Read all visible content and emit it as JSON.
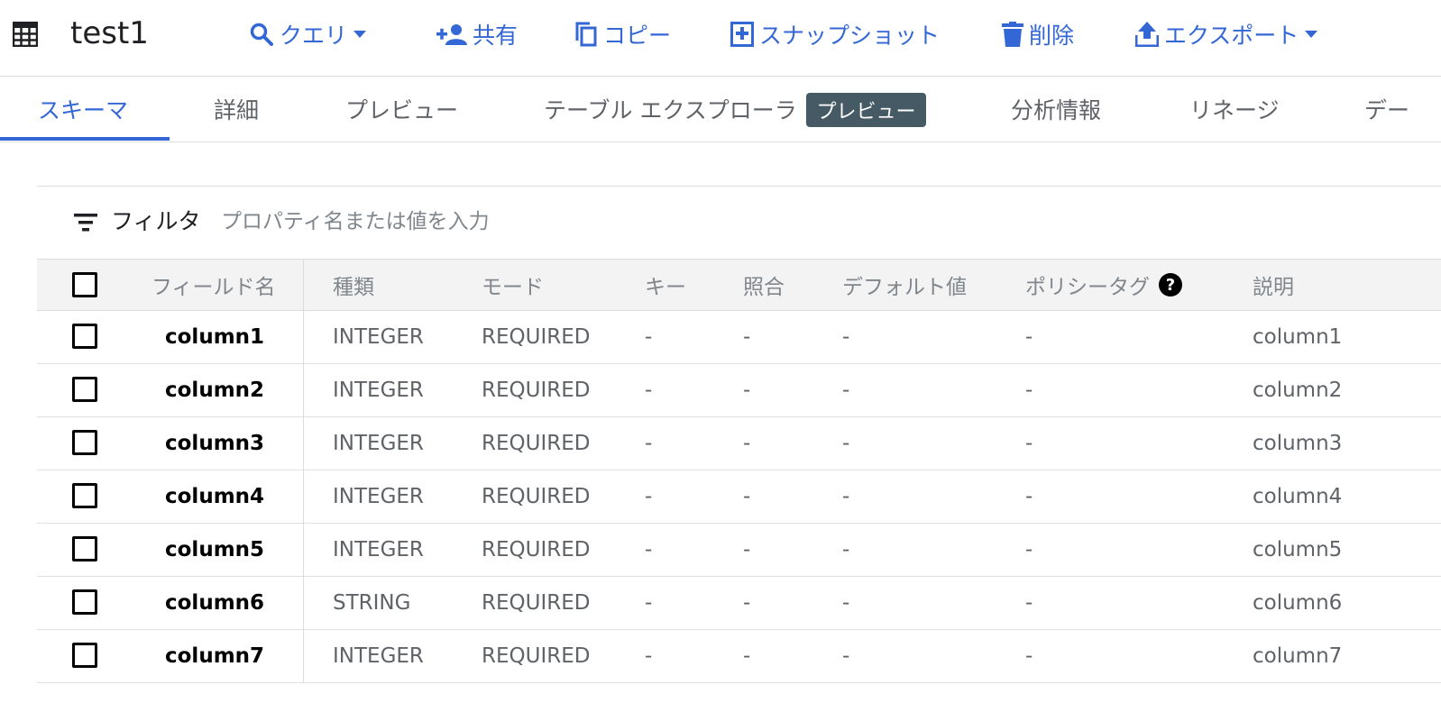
{
  "header": {
    "title": "test1",
    "actions": [
      {
        "label": "クエリ",
        "icon": "search-icon",
        "dropdown": true
      },
      {
        "label": "共有",
        "icon": "person-add-icon"
      },
      {
        "label": "コピー",
        "icon": "copy-icon"
      },
      {
        "label": "スナップショット",
        "icon": "snapshot-icon"
      },
      {
        "label": "削除",
        "icon": "trash-icon"
      },
      {
        "label": "エクスポート",
        "icon": "upload-icon",
        "dropdown": true
      }
    ]
  },
  "tabs": {
    "items": [
      "スキーマ",
      "詳細",
      "プレビュー",
      "テーブル エクスプローラ",
      "分析情報",
      "リネージ",
      "デー"
    ],
    "badge": "プレビュー",
    "active_index": 0
  },
  "filter": {
    "label": "フィルタ",
    "placeholder": "プロパティ名または値を入力"
  },
  "table": {
    "headers": [
      "フィールド名",
      "種類",
      "モード",
      "キー",
      "照合",
      "デフォルト値",
      "ポリシータグ",
      "説明"
    ],
    "help_icon": "?",
    "rows": [
      [
        "column1",
        "INTEGER",
        "REQUIRED",
        "-",
        "-",
        "-",
        "-",
        "column1"
      ],
      [
        "column2",
        "INTEGER",
        "REQUIRED",
        "-",
        "-",
        "-",
        "-",
        "column2"
      ],
      [
        "column3",
        "INTEGER",
        "REQUIRED",
        "-",
        "-",
        "-",
        "-",
        "column3"
      ],
      [
        "column4",
        "INTEGER",
        "REQUIRED",
        "-",
        "-",
        "-",
        "-",
        "column4"
      ],
      [
        "column5",
        "INTEGER",
        "REQUIRED",
        "-",
        "-",
        "-",
        "-",
        "column5"
      ],
      [
        "column6",
        "STRING",
        "REQUIRED",
        "-",
        "-",
        "-",
        "-",
        "column6"
      ],
      [
        "column7",
        "INTEGER",
        "REQUIRED",
        "-",
        "-",
        "-",
        "-",
        "column7"
      ]
    ]
  },
  "colors": {
    "accent": "#3367d6",
    "badge_bg": "#455a64",
    "header_row_bg": "#f3f3f3"
  }
}
